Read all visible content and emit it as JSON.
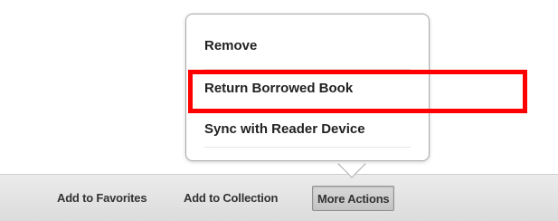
{
  "popup_menu": {
    "items": [
      {
        "label": "Remove"
      },
      {
        "label": "Return Borrowed Book"
      },
      {
        "label": "Sync with Reader Device"
      }
    ]
  },
  "action_bar": {
    "buttons": [
      {
        "label": "Add to Favorites"
      },
      {
        "label": "Add to Collection"
      },
      {
        "label": "More Actions",
        "active": true
      }
    ]
  },
  "colors": {
    "highlight": "#ff0000",
    "bar_background": "#e2e2e2",
    "active_button": "#cdcdcd"
  }
}
